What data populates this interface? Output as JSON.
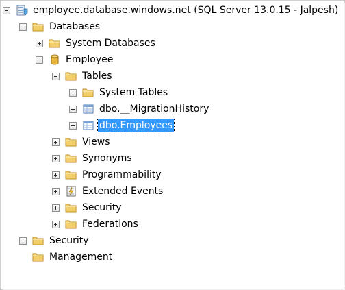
{
  "tree": {
    "server": {
      "label": "employee.database.windows.net (SQL Server 13.0.15 - Jalpesh)"
    },
    "databases": {
      "label": "Databases"
    },
    "system_databases": {
      "label": "System Databases"
    },
    "employee_db": {
      "label": "Employee"
    },
    "tables": {
      "label": "Tables"
    },
    "system_tables": {
      "label": "System Tables"
    },
    "migration_history": {
      "label": "dbo.__MigrationHistory"
    },
    "employees_table": {
      "label": "dbo.Employees",
      "selected": true
    },
    "views": {
      "label": "Views"
    },
    "synonyms": {
      "label": "Synonyms"
    },
    "programmability": {
      "label": "Programmability"
    },
    "extended_events": {
      "label": "Extended Events"
    },
    "db_security": {
      "label": "Security"
    },
    "federations": {
      "label": "Federations"
    },
    "server_security": {
      "label": "Security"
    },
    "management": {
      "label": "Management"
    }
  },
  "colors": {
    "selection": "#3399ff",
    "folder": "#f0c75a"
  }
}
